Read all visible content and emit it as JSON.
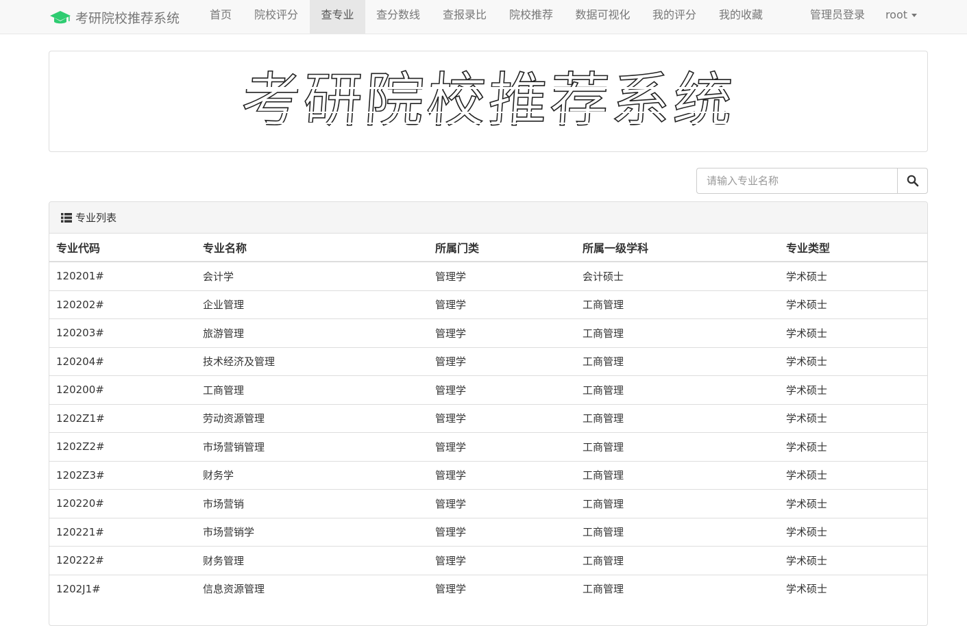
{
  "navbar": {
    "brand": "考研院校推荐系统",
    "items": [
      {
        "label": "首页"
      },
      {
        "label": "院校评分"
      },
      {
        "label": "查专业"
      },
      {
        "label": "查分数线"
      },
      {
        "label": "查报录比"
      },
      {
        "label": "院校推荐"
      },
      {
        "label": "数据可视化"
      },
      {
        "label": "我的评分"
      },
      {
        "label": "我的收藏"
      }
    ],
    "active_item": "查专业",
    "admin_login": "管理员登录",
    "user_menu": "root"
  },
  "banner": {
    "title": "考研院校推荐系统"
  },
  "search": {
    "placeholder": "请输入专业名称",
    "icon": "search-icon"
  },
  "panel": {
    "title": "专业列表",
    "icon": "list-icon",
    "columns": [
      "专业代码",
      "专业名称",
      "所属门类",
      "所属一级学科",
      "专业类型"
    ],
    "rows": [
      [
        "120201#",
        "会计学",
        "管理学",
        "会计硕士",
        "学术硕士"
      ],
      [
        "120202#",
        "企业管理",
        "管理学",
        "工商管理",
        "学术硕士"
      ],
      [
        "120203#",
        "旅游管理",
        "管理学",
        "工商管理",
        "学术硕士"
      ],
      [
        "120204#",
        "技术经济及管理",
        "管理学",
        "工商管理",
        "学术硕士"
      ],
      [
        "120200#",
        "工商管理",
        "管理学",
        "工商管理",
        "学术硕士"
      ],
      [
        "1202Z1#",
        "劳动资源管理",
        "管理学",
        "工商管理",
        "学术硕士"
      ],
      [
        "1202Z2#",
        "市场营销管理",
        "管理学",
        "工商管理",
        "学术硕士"
      ],
      [
        "1202Z3#",
        "财务学",
        "管理学",
        "工商管理",
        "学术硕士"
      ],
      [
        "120220#",
        "市场营销",
        "管理学",
        "工商管理",
        "学术硕士"
      ],
      [
        "120221#",
        "市场营销学",
        "管理学",
        "工商管理",
        "学术硕士"
      ],
      [
        "120222#",
        "财务管理",
        "管理学",
        "工商管理",
        "学术硕士"
      ],
      [
        "1202J1#",
        "信息资源管理",
        "管理学",
        "工商管理",
        "学术硕士"
      ]
    ]
  },
  "colors": {
    "navbar_bg": "#f8f8f8",
    "active_bg": "#e7e7e7",
    "brand_icon": "#2ecc71",
    "border": "#dddddd"
  }
}
